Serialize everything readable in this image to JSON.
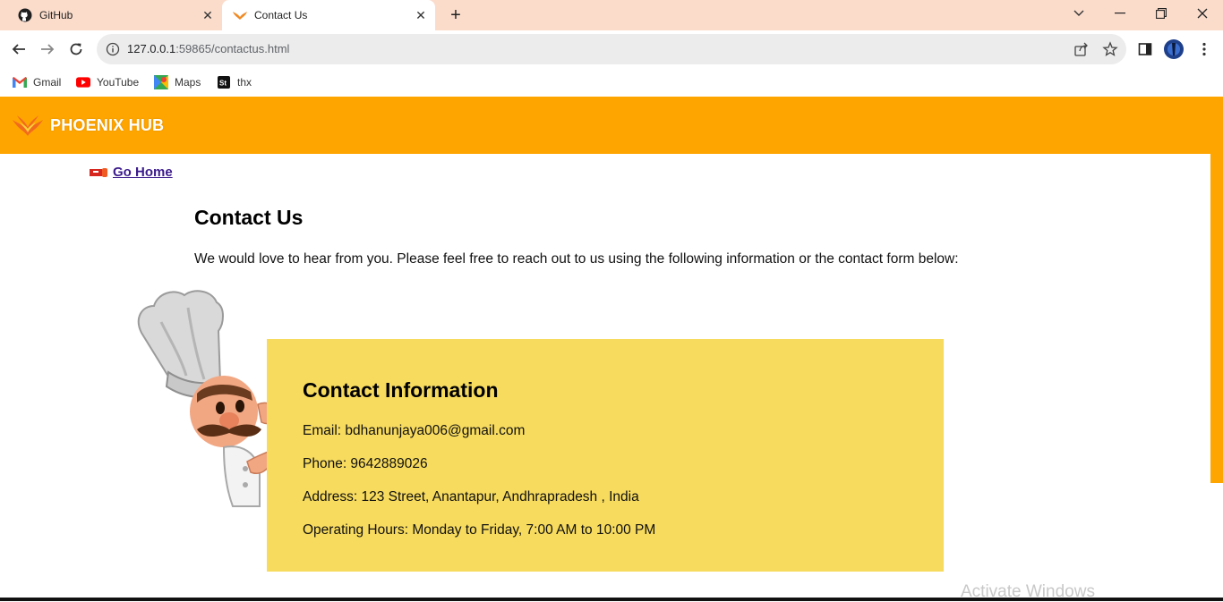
{
  "browser": {
    "tabs": [
      {
        "title": "GitHub",
        "icon": "github-icon",
        "active": false
      },
      {
        "title": "Contact Us",
        "icon": "phoenix-icon",
        "active": true
      }
    ],
    "new_tab_label": "+",
    "url_host": "127.0.0.1",
    "url_path": ":59865/contactus.html",
    "bookmarks": [
      {
        "label": "Gmail",
        "icon": "gmail-icon"
      },
      {
        "label": "YouTube",
        "icon": "youtube-icon"
      },
      {
        "label": "Maps",
        "icon": "maps-icon"
      },
      {
        "label": "thx",
        "icon": "st-icon"
      }
    ],
    "colors": {
      "tabbar": "#fbdccb",
      "omnibox": "#ececec"
    }
  },
  "site": {
    "brand": "PHOENIX HUB",
    "header_color": "#ffa500",
    "home_link": "Go Home",
    "title": "Contact Us",
    "intro": "We would love to hear from you. Please feel free to reach out to us using the following information or the contact form below:"
  },
  "contact": {
    "heading": "Contact Information",
    "box_color": "#f7db5e",
    "email": "Email: bdhanunjaya006@gmail.com",
    "phone": "Phone: 9642889026",
    "address": "Address: 123 Street, Anantapur, Andhrapradesh , India",
    "hours": "Operating Hours: Monday to Friday, 7:00 AM to 10:00 PM"
  },
  "system": {
    "watermark": "Activate Windows"
  }
}
